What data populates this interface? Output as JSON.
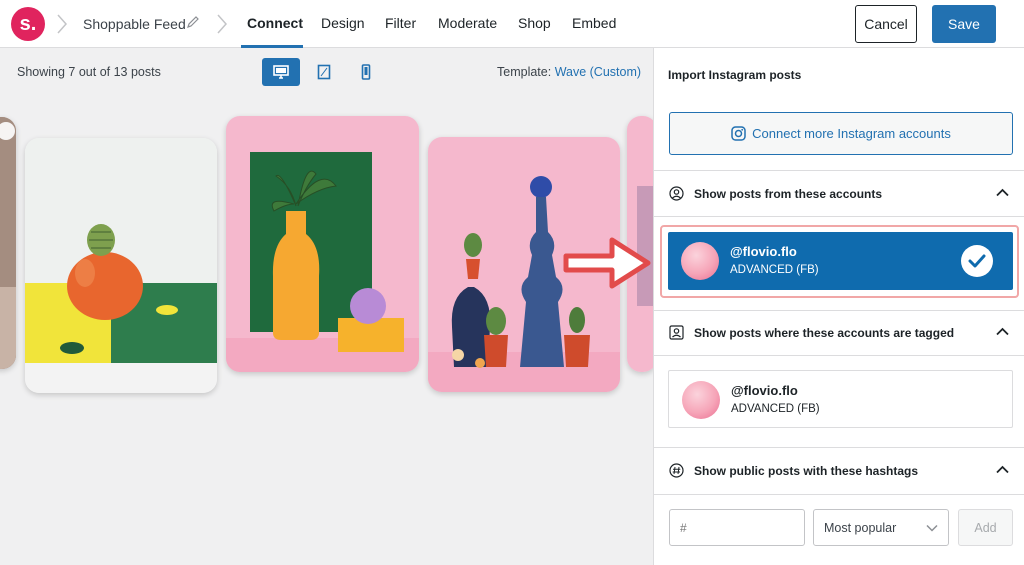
{
  "header": {
    "logo_letter": "s.",
    "feed_name": "Shoppable Feed",
    "tabs": [
      {
        "label": "Connect",
        "active": true
      },
      {
        "label": "Design"
      },
      {
        "label": "Filter"
      },
      {
        "label": "Moderate"
      },
      {
        "label": "Shop"
      },
      {
        "label": "Embed"
      }
    ],
    "cancel_label": "Cancel",
    "save_label": "Save"
  },
  "preview": {
    "showing_text": "Showing 7 out of 13 posts",
    "template_label": "Template:",
    "template_value": "Wave (Custom)",
    "devices": [
      "desktop",
      "tablet",
      "mobile"
    ]
  },
  "panel": {
    "title": "Import Instagram posts",
    "connect_label": "Connect more Instagram accounts",
    "section_accounts": "Show posts from these accounts",
    "section_tagged": "Show posts where these accounts are tagged",
    "section_hashtags": "Show public posts with these hashtags",
    "account_selected": {
      "handle": "@flovio.flo",
      "type": "ADVANCED (FB)"
    },
    "account_tagged": {
      "handle": "@flovio.flo",
      "type": "ADVANCED (FB)"
    },
    "hashtag_placeholder": "#",
    "sort_value": "Most popular",
    "add_label": "Add"
  },
  "colors": {
    "accent": "#2271b1",
    "selected": "#0f6bae",
    "brand": "#e0245e"
  }
}
